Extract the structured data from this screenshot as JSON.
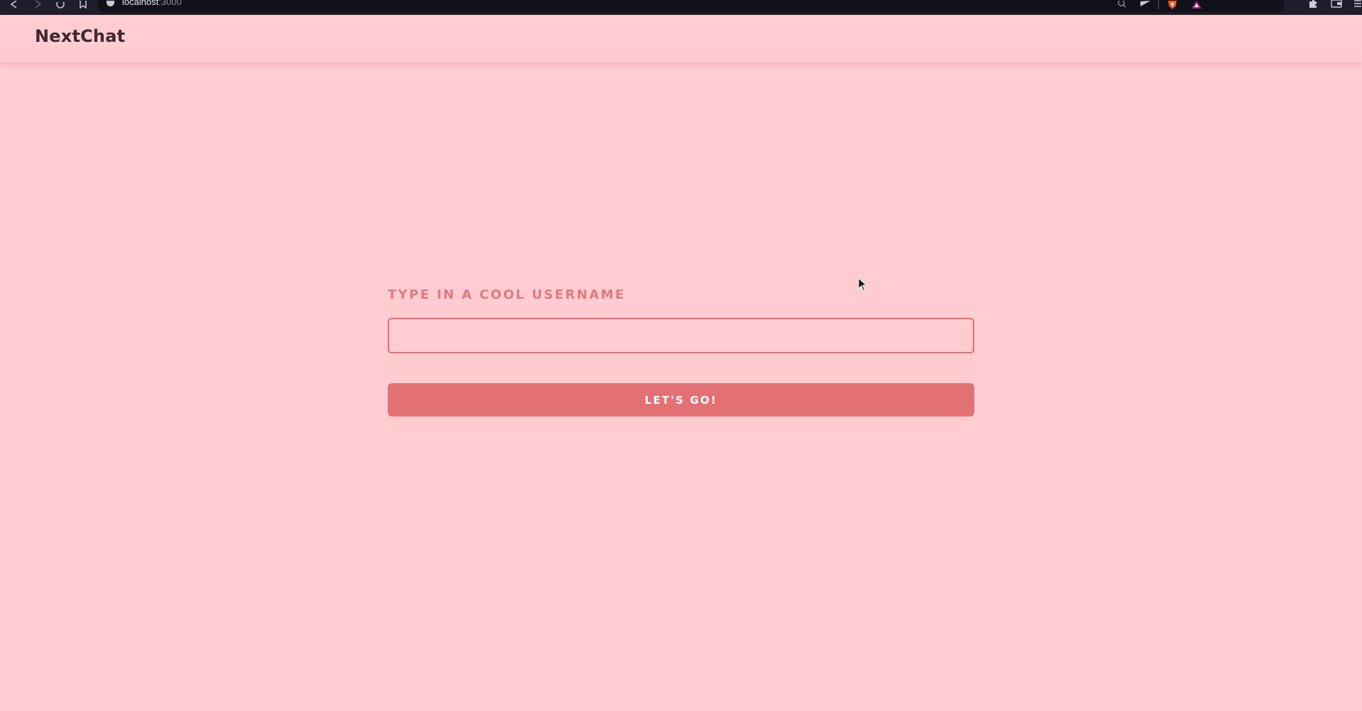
{
  "browser": {
    "url_host": "localhost",
    "url_port": ":3000"
  },
  "app": {
    "title": "NextChat"
  },
  "login": {
    "label": "TYPE IN A COOL USERNAME",
    "input_value": "",
    "input_placeholder": "",
    "submit_label": "LET'S GO!"
  },
  "colors": {
    "background": "#ffccd2",
    "accent": "#e37173",
    "label": "#e07a7e",
    "title": "#3d2a30"
  }
}
